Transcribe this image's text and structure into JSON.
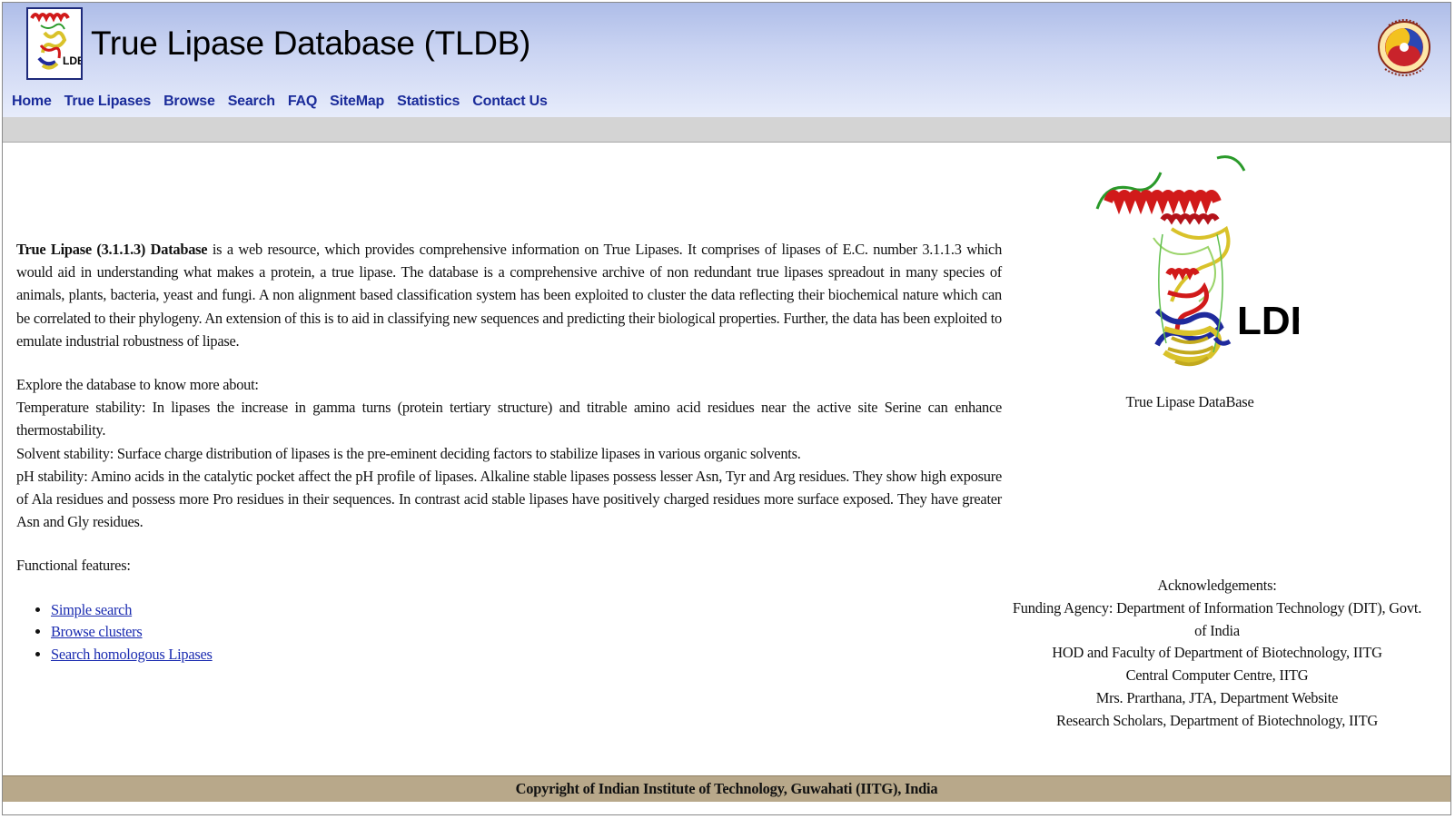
{
  "header": {
    "title": "True Lipase Database (TLDB)",
    "logo_text": "LDB"
  },
  "nav": {
    "items": [
      "Home",
      "True Lipases",
      "Browse",
      "Search",
      "FAQ",
      "SiteMap",
      "Statistics",
      "Contact Us"
    ]
  },
  "intro": {
    "bold_lead": "True Lipase (3.1.1.3) Database",
    "text": " is a web resource, which provides comprehensive information on True Lipases. It comprises of lipases of E.C. number 3.1.1.3 which would aid in understanding what makes a protein, a true lipase. The database is a comprehensive archive of non redundant true lipases spreadout in many species of animals, plants, bacteria, yeast and fungi. A non alignment based classification system has been exploited to cluster the data reflecting their biochemical nature which can be correlated to their phylogeny. An extension of this is to aid in classifying new sequences and predicting their biological properties. Further, the data has been exploited to emulate industrial robustness of lipase."
  },
  "explore": {
    "heading": "Explore the database to know more about:",
    "temperature": "Temperature stability: In lipases the increase in gamma turns (protein tertiary structure) and titrable amino acid residues near the active site Serine can enhance thermostability.",
    "solvent": "Solvent stability: Surface charge distribution of lipases is the pre-eminent deciding factors to stabilize lipases in various organic solvents.",
    "ph": "pH stability: Amino acids in the catalytic pocket affect the pH profile of lipases. Alkaline stable lipases possess lesser Asn, Tyr and Arg residues. They show high exposure of Ala residues and possess more Pro residues in their sequences. In contrast acid stable lipases have positively charged residues more surface exposed. They have greater Asn and Gly residues."
  },
  "features": {
    "heading": "Functional features:",
    "links": [
      "Simple search",
      "Browse clusters",
      "Search homologous Lipases"
    ]
  },
  "side": {
    "image_label": "LDB",
    "caption": "True Lipase DataBase"
  },
  "acknowledgements": {
    "heading": "Acknowledgements:",
    "lines": [
      "Funding Agency: Department of Information Technology (DIT), Govt. of India",
      "HOD and Faculty of Department of Biotechnology, IITG",
      "Central Computer Centre, IITG",
      "Mrs. Prarthana, JTA, Department Website",
      "Research Scholars, Department of Biotechnology, IITG"
    ]
  },
  "footer": {
    "copyright": "Copyright of Indian Institute of Technology, Guwahati (IITG), India"
  },
  "colors": {
    "nav_link": "#1a2b9a",
    "header_gradient_top": "#aebde8",
    "footer_bg": "#b8a88a",
    "helix_red": "#d11a1a",
    "sheet_yellow": "#d9c22a",
    "strand_blue": "#1f2a9c"
  }
}
